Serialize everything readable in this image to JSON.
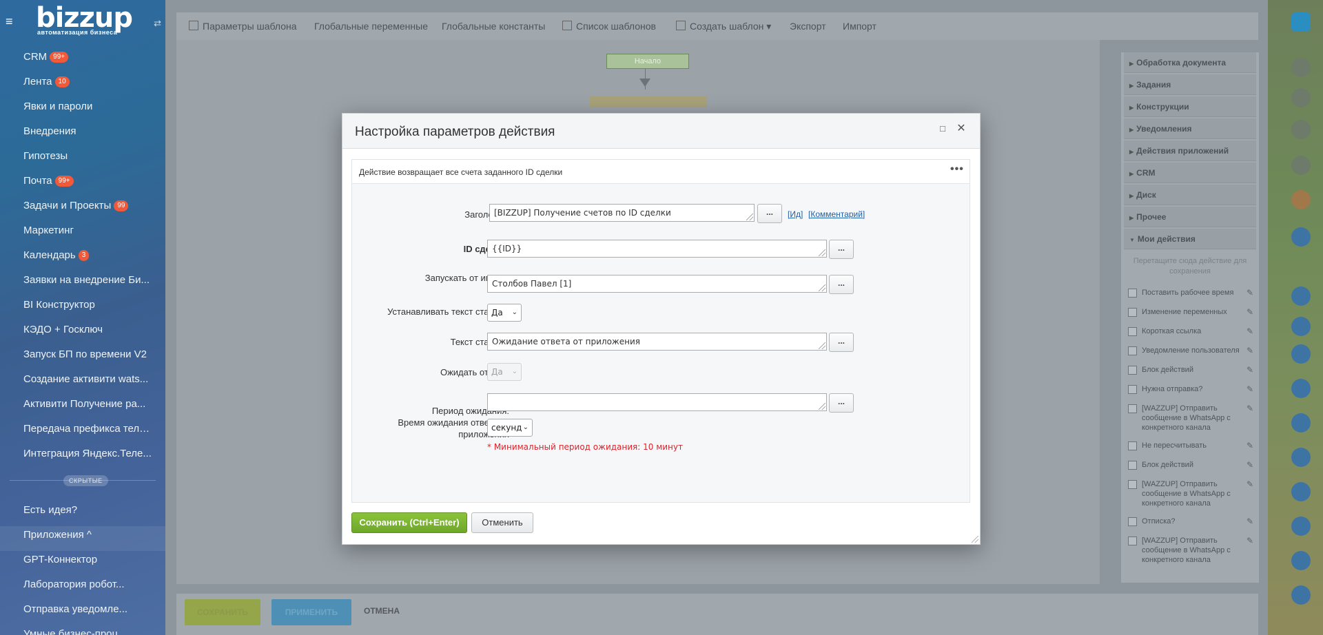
{
  "sidebar": {
    "logo_text": "bizzup",
    "logo_sub": "автоматизация бизнеса",
    "items": [
      {
        "label": "CRM",
        "badge": "99+"
      },
      {
        "label": "Лента",
        "badge": "10"
      },
      {
        "label": "Явки и пароли",
        "badge": ""
      },
      {
        "label": "Внедрения",
        "badge": ""
      },
      {
        "label": "Гипотезы",
        "badge": ""
      },
      {
        "label": "Почта",
        "badge": "99+"
      },
      {
        "label": "Задачи и Проекты",
        "badge": "99"
      },
      {
        "label": "Маркетинг",
        "badge": ""
      },
      {
        "label": "Календарь",
        "badge": "3"
      },
      {
        "label": "Заявки на внедрение Би...",
        "badge": ""
      },
      {
        "label": "BI Конструктор",
        "badge": ""
      },
      {
        "label": "КЭДО + Госключ",
        "badge": ""
      },
      {
        "label": "Запуск БП по времени V2",
        "badge": ""
      },
      {
        "label": "Создание активити wats...",
        "badge": ""
      },
      {
        "label": "Активити Получение ра...",
        "badge": ""
      },
      {
        "label": "Передача префикса теле...",
        "badge": ""
      },
      {
        "label": "Интеграция Яндекс.Теле...",
        "badge": ""
      }
    ],
    "hidden_label": "СКРЫТЫЕ",
    "items2": [
      {
        "label": "Есть идея?"
      },
      {
        "label": "Приложения ^"
      },
      {
        "label": "GPT-Коннектор"
      },
      {
        "label": "Лаборатория робот..."
      },
      {
        "label": "Отправка уведомле..."
      },
      {
        "label": "Умные бизнес-проц..."
      }
    ]
  },
  "toolbar": {
    "items": [
      "Параметры шаблона",
      "Глобальные переменные",
      "Глобальные константы",
      "Список шаблонов",
      "Создать шаблон ▾",
      "Экспорт",
      "Импорт"
    ]
  },
  "canvas": {
    "start_label": "Начало"
  },
  "bottom": {
    "save": "СОХРАНИТЬ",
    "apply": "ПРИМЕНИТЬ",
    "cancel": "ОТМЕНА"
  },
  "right_panel": {
    "groups": [
      "Обработка документа",
      "Задания",
      "Конструкции",
      "Уведомления",
      "Действия приложений",
      "CRM",
      "Диск",
      "Прочее",
      "Мои действия"
    ],
    "drop_hint": "Перетащите сюда действие для сохранения",
    "actions": [
      "Поставить рабочее время",
      "Изменение переменных",
      "Короткая ссылка",
      "Уведомление пользователя",
      "Блок действий",
      "Нужна отправка?",
      "[WAZZUP] Отправить сообщение в WhatsApp с конкретного канала",
      "Не пересчитывать",
      "Блок действий",
      "[WAZZUP] Отправить сообщение в WhatsApp с конкретного канала",
      "Отписка?",
      "[WAZZUP] Отправить сообщение в WhatsApp с конкретного канала"
    ]
  },
  "dialog": {
    "title": "Настройка параметров действия",
    "description": "Действие возвращает все счета заданного ID сделки",
    "fields": {
      "title_label": "Заголовок:",
      "title_value": "[BIZZUP] Получение счетов по ID сделки",
      "id_link": "[Ид]",
      "comment_link": "[Комментарий]",
      "deal_id_label": "ID сделки:",
      "deal_id_value": "{{ID}}",
      "run_as_label": "Запускать от имени:",
      "run_as_value": "Столбов Павел [1]",
      "set_status_label": "Устанавливать текст статуса:",
      "set_status_value": "Да",
      "status_text_label": "Текст статуса:",
      "status_text_value": "Ожидание ответа от приложения",
      "wait_label": "Ожидать ответа:",
      "wait_value": "Да",
      "period_label_1": "Период ожидания:",
      "period_label_2": "Время ожидания ответа от",
      "period_label_3": "приложения",
      "period_value": "",
      "period_unit": "секунд",
      "min_note": "* Минимальный период ожидания: 10 минут",
      "dots": "..."
    },
    "save_button": "Сохранить (Ctrl+Enter)",
    "cancel_button": "Отменить"
  },
  "colors": {
    "save_green": "#7ab532",
    "link_blue": "#1f5fa8",
    "note_red": "#e0202a"
  }
}
